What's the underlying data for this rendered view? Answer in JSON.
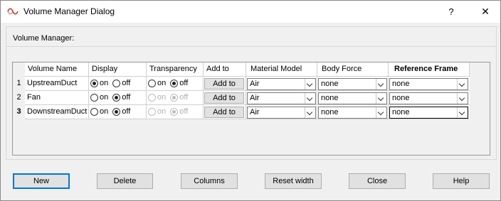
{
  "window": {
    "title": "Volume Manager Dialog",
    "help": "?",
    "close": "✕"
  },
  "group": {
    "label": "Volume Manager:"
  },
  "table": {
    "headers": {
      "name": "Volume Name",
      "display": "Display",
      "transparency": "Transparency",
      "add_to": "Add to",
      "material": "Material Model",
      "body_force": "Body Force",
      "ref_frame": "Reference Frame"
    },
    "on_label": "on",
    "off_label": "off",
    "rows": [
      {
        "num": "1",
        "name": "UpstreamDuct",
        "display": "on",
        "transparency": "off",
        "transparency_enabled": true,
        "add_to": "Add to",
        "material": "Air",
        "body_force": "none",
        "ref_frame": "none"
      },
      {
        "num": "2",
        "name": "Fan",
        "display": "off",
        "transparency": "off",
        "transparency_enabled": false,
        "add_to": "Add to",
        "material": "Air",
        "body_force": "none",
        "ref_frame": "none"
      },
      {
        "num": "3",
        "name": "DownstreamDuct",
        "display": "off",
        "transparency": "off",
        "transparency_enabled": false,
        "add_to": "Add to",
        "material": "Air",
        "body_force": "none",
        "ref_frame": "none"
      }
    ]
  },
  "buttons": {
    "new": "New",
    "delete": "Delete",
    "columns": "Columns",
    "reset_width": "Reset width",
    "close": "Close",
    "help": "Help"
  }
}
